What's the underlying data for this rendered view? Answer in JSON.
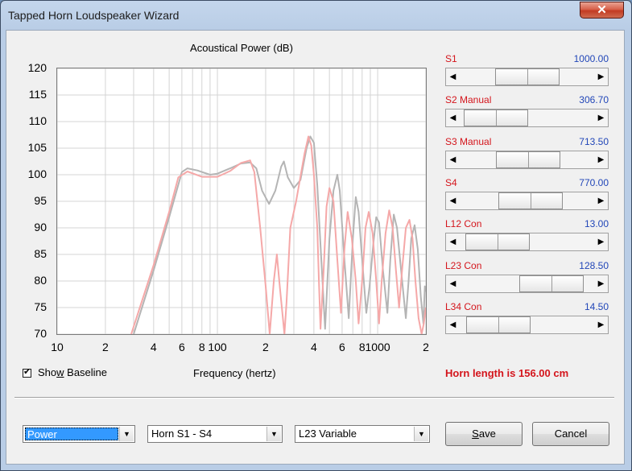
{
  "window": {
    "title": "Tapped Horn Loudspeaker Wizard",
    "close_glyph": "✕"
  },
  "chart_data": {
    "type": "line",
    "title": "Acoustical Power (dB)",
    "xlabel": "Frequency (hertz)",
    "ylabel": "",
    "x_scale": "log",
    "xlim": [
      10,
      2000
    ],
    "ylim": [
      70,
      120
    ],
    "y_ticks": [
      "120",
      "115",
      "110",
      "105",
      "100",
      "95",
      "90",
      "85",
      "80",
      "75",
      "70"
    ],
    "x_ticks": [
      {
        "label": "10",
        "value": 10
      },
      {
        "label": "2",
        "value": 20
      },
      {
        "label": "4",
        "value": 40
      },
      {
        "label": "6",
        "value": 60
      },
      {
        "label": "8",
        "value": 80
      },
      {
        "label": "100",
        "value": 100
      },
      {
        "label": "2",
        "value": 200
      },
      {
        "label": "4",
        "value": 400
      },
      {
        "label": "6",
        "value": 600
      },
      {
        "label": "8",
        "value": 800
      },
      {
        "label": "1000",
        "value": 1000
      },
      {
        "label": "2",
        "value": 2000
      }
    ],
    "grid": true,
    "series": [
      {
        "color": "#b4b4b4",
        "points": [
          [
            30,
            70
          ],
          [
            40,
            82
          ],
          [
            50,
            92
          ],
          [
            60,
            100.5
          ],
          [
            65,
            101.2
          ],
          [
            75,
            100.8
          ],
          [
            90,
            100
          ],
          [
            100,
            100.2
          ],
          [
            120,
            101.2
          ],
          [
            140,
            102.1
          ],
          [
            160,
            102.3
          ],
          [
            175,
            101.2
          ],
          [
            190,
            97
          ],
          [
            210,
            94.5
          ],
          [
            230,
            97
          ],
          [
            250,
            101.5
          ],
          [
            260,
            102.5
          ],
          [
            275,
            99.5
          ],
          [
            300,
            97.5
          ],
          [
            330,
            99
          ],
          [
            360,
            105
          ],
          [
            380,
            107.2
          ],
          [
            400,
            106
          ],
          [
            420,
            98
          ],
          [
            445,
            84
          ],
          [
            470,
            71
          ],
          [
            500,
            88
          ],
          [
            530,
            97
          ],
          [
            560,
            100
          ],
          [
            580,
            97
          ],
          [
            620,
            84
          ],
          [
            660,
            73
          ],
          [
            700,
            88
          ],
          [
            730,
            95.8
          ],
          [
            760,
            93
          ],
          [
            800,
            84
          ],
          [
            850,
            74
          ],
          [
            890,
            79
          ],
          [
            940,
            87
          ],
          [
            980,
            92
          ],
          [
            1020,
            91
          ],
          [
            1080,
            82
          ],
          [
            1150,
            74
          ],
          [
            1200,
            84
          ],
          [
            1260,
            92.5
          ],
          [
            1320,
            90
          ],
          [
            1400,
            82
          ],
          [
            1500,
            73
          ],
          [
            1560,
            80
          ],
          [
            1620,
            88
          ],
          [
            1700,
            90.5
          ],
          [
            1780,
            86
          ],
          [
            1860,
            77
          ],
          [
            1930,
            72
          ],
          [
            1970,
            79
          ],
          [
            2000,
            78
          ]
        ]
      },
      {
        "color": "#f5a8a8",
        "points": [
          [
            29,
            70
          ],
          [
            40,
            83
          ],
          [
            50,
            93
          ],
          [
            57,
            99.5
          ],
          [
            65,
            100.6
          ],
          [
            80,
            99.6
          ],
          [
            100,
            99.6
          ],
          [
            120,
            100.7
          ],
          [
            140,
            102.2
          ],
          [
            160,
            102.7
          ],
          [
            170,
            100.5
          ],
          [
            185,
            90
          ],
          [
            200,
            79
          ],
          [
            212,
            70
          ],
          [
            225,
            80
          ],
          [
            235,
            85
          ],
          [
            245,
            79
          ],
          [
            262,
            70
          ],
          [
            270,
            76
          ],
          [
            285,
            90
          ],
          [
            310,
            95
          ],
          [
            350,
            104
          ],
          [
            370,
            107.2
          ],
          [
            385,
            105.5
          ],
          [
            400,
            100
          ],
          [
            420,
            90
          ],
          [
            430,
            80
          ],
          [
            440,
            71
          ],
          [
            460,
            82
          ],
          [
            480,
            94
          ],
          [
            500,
            97.5
          ],
          [
            530,
            95
          ],
          [
            560,
            84
          ],
          [
            590,
            74
          ],
          [
            620,
            86
          ],
          [
            650,
            93
          ],
          [
            690,
            88
          ],
          [
            730,
            80
          ],
          [
            760,
            72
          ],
          [
            800,
            80
          ],
          [
            840,
            90
          ],
          [
            880,
            93
          ],
          [
            930,
            89
          ],
          [
            980,
            80
          ],
          [
            1020,
            72
          ],
          [
            1060,
            80
          ],
          [
            1120,
            89
          ],
          [
            1180,
            93.3
          ],
          [
            1240,
            90
          ],
          [
            1300,
            82
          ],
          [
            1360,
            75
          ],
          [
            1420,
            82
          ],
          [
            1500,
            90
          ],
          [
            1580,
            91.5
          ],
          [
            1650,
            88
          ],
          [
            1720,
            80
          ],
          [
            1800,
            73
          ],
          [
            1880,
            70
          ],
          [
            1940,
            72
          ],
          [
            2000,
            75
          ]
        ]
      }
    ]
  },
  "baseline": {
    "label_pre": "Sho",
    "label_accel": "w",
    "label_post": " Baseline",
    "checked": true,
    "check_glyph": "✔"
  },
  "sliders": [
    {
      "label": "S1",
      "value": "1000.00",
      "position": 0.5
    },
    {
      "label": "S2  Manual",
      "value": "306.70",
      "position": 0.06
    },
    {
      "label": "S3  Manual",
      "value": "713.50",
      "position": 0.52
    },
    {
      "label": "S4",
      "value": "770.00",
      "position": 0.55
    },
    {
      "label": "L12  Con",
      "value": "13.00",
      "position": 0.08
    },
    {
      "label": "L23  Con",
      "value": "128.50",
      "position": 0.85
    },
    {
      "label": "L34  Con",
      "value": "14.50",
      "position": 0.09
    }
  ],
  "scroll_glyphs": {
    "left": "◀",
    "right": "▶"
  },
  "horn_length": "Horn length is 156.00 cm",
  "combos": [
    {
      "value": "Power",
      "selected": true
    },
    {
      "value": "Horn S1 - S4",
      "selected": false
    },
    {
      "value": "L23 Variable",
      "selected": false
    }
  ],
  "dropdown_glyph": "▼",
  "buttons": {
    "save_accel": "S",
    "save_rest": "ave",
    "cancel": "Cancel"
  },
  "colors": {
    "label_red": "#d4151c",
    "value_blue": "#2146b8",
    "grid": "#d4d4d4"
  }
}
